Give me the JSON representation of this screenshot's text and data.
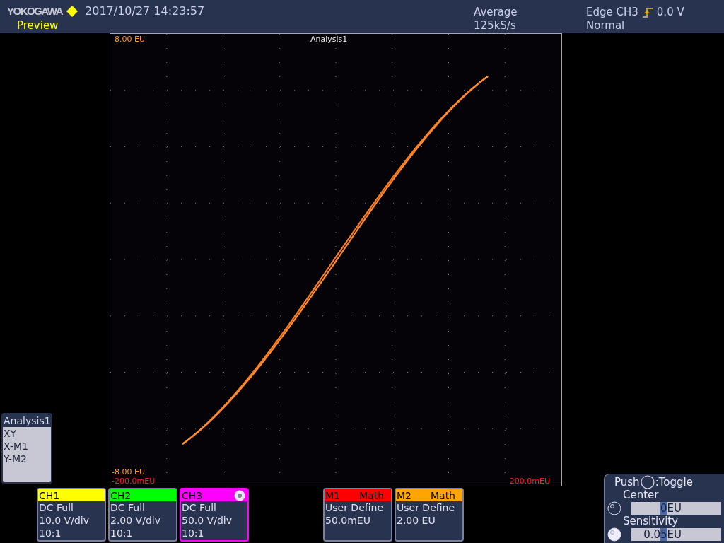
{
  "header": {
    "brand": "YOKOGAWA",
    "datetime": "2017/10/27 14:23:57",
    "mode": "Preview",
    "acquisition": {
      "type": "Average",
      "rate": "125kS/s"
    },
    "trigger": {
      "source": "Edge CH3",
      "level": "0.0 V",
      "mode": "Normal"
    }
  },
  "plot": {
    "title": "Analysis1",
    "y_top": "8.00 EU",
    "y_bottom": "-8.00 EU",
    "x_left": "-200.0mEU",
    "x_right": "200.0mEU"
  },
  "analysis_panel": {
    "title": "Analysis1",
    "lines": [
      "XY",
      "X-M1",
      "Y-M2"
    ]
  },
  "channels": [
    {
      "kind": "channel",
      "name": "CH1",
      "color": "#ffff00",
      "selected": false,
      "lines": [
        "DC Full",
        "10.0 V/div",
        "10:1"
      ]
    },
    {
      "kind": "channel",
      "name": "CH2",
      "color": "#00ff00",
      "selected": false,
      "lines": [
        "DC Full",
        "2.00 V/div",
        "10:1"
      ]
    },
    {
      "kind": "channel",
      "name": "CH3",
      "color": "#ff00ff",
      "selected": true,
      "lines": [
        "DC Full",
        "50.0 V/div",
        "10:1"
      ]
    },
    {
      "kind": "math",
      "name": "M1",
      "type": "Math",
      "color": "#ff0000",
      "selected": false,
      "lines": [
        "User Define",
        "50.0mEU"
      ]
    },
    {
      "kind": "math",
      "name": "M2",
      "type": "Math",
      "color": "#ffa500",
      "selected": false,
      "lines": [
        "User Define",
        "2.00 EU"
      ]
    }
  ],
  "knob_panel": {
    "push": "Push",
    "toggle": ":Toggle",
    "settings": [
      {
        "label": "Center",
        "active": false,
        "cursor": "0",
        "after": "EU"
      },
      {
        "label": "Sensitivity",
        "active": true,
        "before": "0.0",
        "cursor": "5",
        "after": "EU"
      }
    ]
  }
}
